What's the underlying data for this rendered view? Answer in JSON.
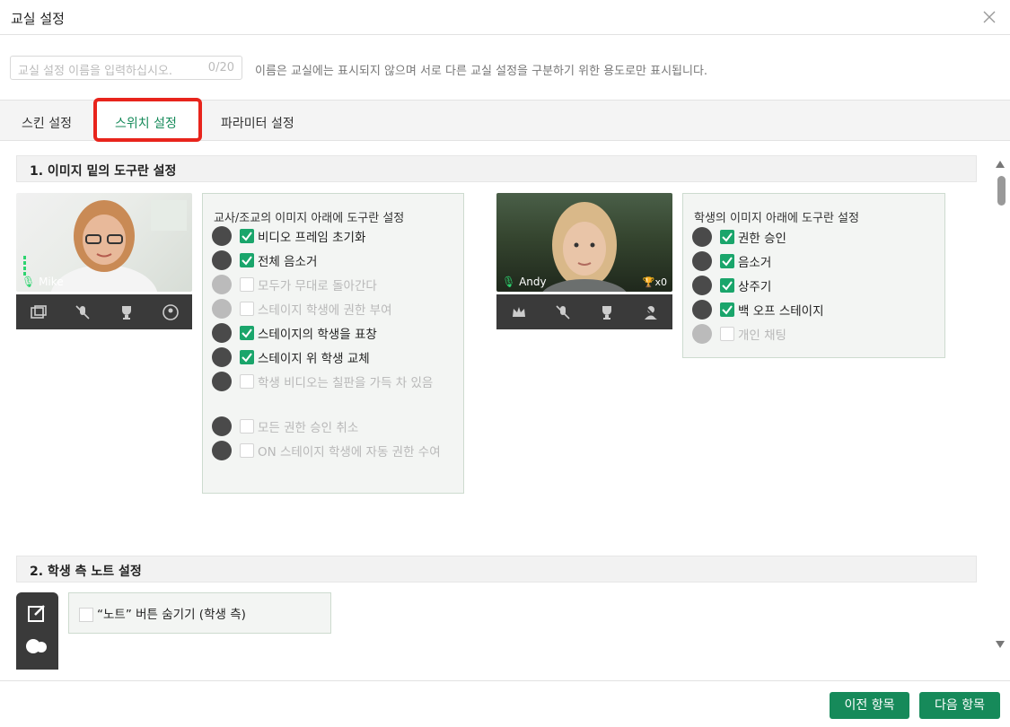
{
  "dialog": {
    "title": "교실 설정"
  },
  "name_field": {
    "placeholder": "교실 설정 이름을 입력하십시오.",
    "counter": "0/20",
    "hint": "이름은 교실에는 표시되지 않으며 서로 다른 교실 설정을 구분하기 위한 용도로만 표시됩니다."
  },
  "tabs": [
    {
      "label": "스킨 설정"
    },
    {
      "label": "스위치 설정",
      "active": true
    },
    {
      "label": "파라미터 설정"
    }
  ],
  "section1": {
    "title": "1. 이미지 밑의 도구란 설정",
    "teacher": {
      "name": "Mike",
      "panel_title": "교사/조교의 이미지 아래에 도구란 설정",
      "options": [
        {
          "label": "비디오 프레임 초기화",
          "checked": true,
          "icon": "video-frame-icon"
        },
        {
          "label": "전체 음소거",
          "checked": true,
          "icon": "mute-all-icon"
        },
        {
          "label": "모두가 무대로 돌아간다",
          "checked": false,
          "icon": "all-stage-icon"
        },
        {
          "label": "스테이지 학생에 권한 부여",
          "checked": false,
          "icon": "grant-icon"
        },
        {
          "label": "스테이지의 학생을 표창",
          "checked": true,
          "icon": "trophy-icon"
        },
        {
          "label": "스테이지 위 학생 교체",
          "checked": true,
          "icon": "swap-icon"
        },
        {
          "label": "학생 비디오는 칠판을 가득 차 있음",
          "checked": false,
          "icon": "grid-icon"
        },
        {
          "label": "모든 권한 승인 취소",
          "checked": false,
          "icon": "revoke-icon"
        },
        {
          "label": "ON 스테이지 학생에 자동 권한 수여",
          "checked": false,
          "icon": "auto-grant-icon"
        }
      ]
    },
    "student": {
      "name": "Andy",
      "trophy_count": "x0",
      "panel_title": "학생의 이미지 아래에 도구란 설정",
      "options": [
        {
          "label": "권한 승인",
          "checked": true,
          "icon": "crown-icon"
        },
        {
          "label": "음소거",
          "checked": true,
          "icon": "mic-off-icon"
        },
        {
          "label": "상주기",
          "checked": true,
          "icon": "trophy-icon"
        },
        {
          "label": "백 오프 스테이지",
          "checked": true,
          "icon": "off-stage-icon"
        },
        {
          "label": "개인 채팅",
          "checked": false,
          "icon": "chat-icon"
        }
      ]
    }
  },
  "section2": {
    "title": "2. 학생 측 노트 설정",
    "option": {
      "label": "“노트” 버튼 숨기기 (학생 측)",
      "checked": false
    }
  },
  "footer": {
    "prev": "이전 항목",
    "next": "다음 항목"
  },
  "colors": {
    "accent": "#168a5a",
    "highlight": "#e8241c",
    "check": "#1aa56b"
  }
}
